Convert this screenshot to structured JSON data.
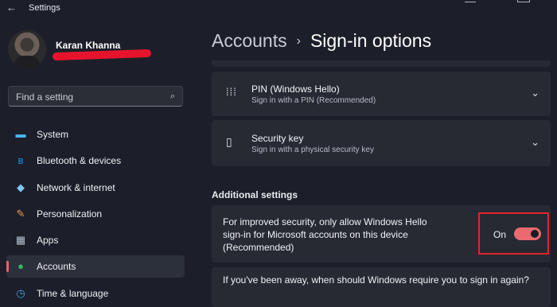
{
  "window": {
    "title": "Settings"
  },
  "user": {
    "name": "Karan Khanna"
  },
  "search": {
    "placeholder": "Find a setting"
  },
  "nav": [
    {
      "label": "System",
      "icon": "monitor-icon",
      "color": "#4fb3ef"
    },
    {
      "label": "Bluetooth & devices",
      "icon": "bluetooth-icon",
      "color": "#1e8fe0"
    },
    {
      "label": "Network & internet",
      "icon": "wifi-icon",
      "color": "#7fc6f2"
    },
    {
      "label": "Personalization",
      "icon": "brush-icon",
      "color": "#e69b55"
    },
    {
      "label": "Apps",
      "icon": "apps-icon",
      "color": "#b9c2d0"
    },
    {
      "label": "Accounts",
      "icon": "person-icon",
      "color": "#39b46b",
      "active": true
    },
    {
      "label": "Time & language",
      "icon": "globe-clock-icon",
      "color": "#43a3e0"
    }
  ],
  "breadcrumb": {
    "parent": "Accounts",
    "separator": "›",
    "current": "Sign-in options"
  },
  "signin_methods": [
    {
      "title": "PIN (Windows Hello)",
      "subtitle": "Sign in with a PIN (Recommended)",
      "icon": "keypad-icon"
    },
    {
      "title": "Security key",
      "subtitle": "Sign in with a physical security key",
      "icon": "usb-key-icon"
    }
  ],
  "additional": {
    "heading": "Additional settings",
    "hello_only": {
      "text": "For improved security, only allow Windows Hello sign-in for Microsoft accounts on this device (Recommended)",
      "state_label": "On",
      "on": true
    },
    "away_question": "If you've been away, when should Windows require you to sign in again?"
  },
  "colors": {
    "accent": "#ea6a70",
    "highlight": "#e3242b",
    "redaction": "#e5142c"
  }
}
